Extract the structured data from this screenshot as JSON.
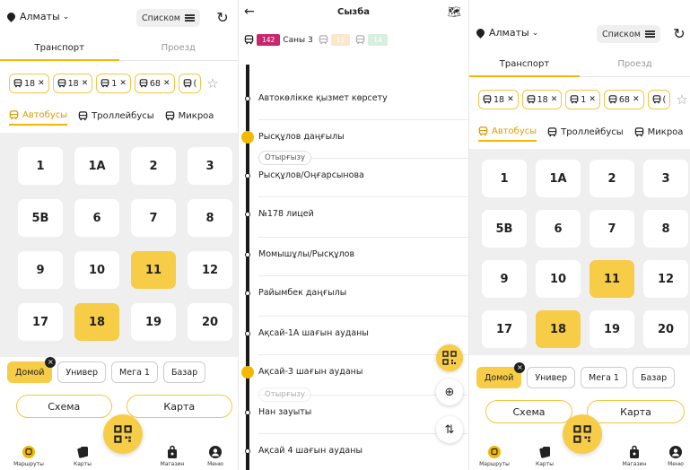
{
  "left_panel": {
    "city": "Алматы",
    "list_button": "Списком",
    "tabs": [
      "Транспорт",
      "Проезд"
    ],
    "chips": [
      "18",
      "18",
      "1",
      "68",
      "("
    ],
    "transport_tabs": [
      "Автобусы",
      "Троллейбусы",
      "Микроа"
    ],
    "routes": [
      "1",
      "1А",
      "2",
      "3",
      "5В",
      "6",
      "7",
      "8",
      "9",
      "10",
      "11",
      "12",
      "17",
      "18",
      "19",
      "20"
    ],
    "selected_routes": [
      "11",
      "18"
    ],
    "quick_places": [
      "Домой",
      "Универ",
      "Мега 1",
      "Базар"
    ],
    "quick_badge": "×",
    "scheme_button": "Схема",
    "map_button": "Карта",
    "nav": [
      "Маршруты",
      "Карты",
      "Магазин",
      "Меню"
    ]
  },
  "right_panel": {
    "city": "Алматы",
    "list_button": "Списком",
    "tabs": [
      "Транспорт",
      "Проезд"
    ],
    "chips": [
      "18",
      "18",
      "1",
      "68",
      "("
    ],
    "transport_tabs": [
      "Автобусы",
      "Троллейбусы",
      "Микроа"
    ],
    "routes": [
      "1",
      "1А",
      "2",
      "3",
      "5В",
      "6",
      "7",
      "8",
      "9",
      "10",
      "11",
      "12",
      "17",
      "18",
      "19",
      "20"
    ],
    "selected_routes": [
      "11",
      "18"
    ],
    "quick_places": [
      "Домой",
      "Универ",
      "Мега 1",
      "Базар"
    ],
    "quick_badge": "×",
    "scheme_button": "Схема",
    "map_button": "Карта",
    "nav": [
      "Маршруты",
      "Карты",
      "Магазин",
      "Меню"
    ]
  },
  "middle_panel": {
    "title": "Сызба",
    "vehicles": [
      {
        "tag": "142",
        "text": "Саны 3",
        "color": "#c8276e",
        "faded": false
      },
      {
        "tag": "11",
        "text": "",
        "color": "#f0c070",
        "faded": true
      },
      {
        "tag": "14",
        "text": "",
        "color": "#8fd4a0",
        "faded": true
      }
    ],
    "stops": [
      "Автокөлікке қызмет көрсету",
      "Рысқұлов даңғылы",
      "Рысқұлов/Оңғарсынова",
      "№178 лицей",
      "Момышұлы/Рысқұлов",
      "Райымбек даңғылы",
      "Ақсай-1А шағын ауданы",
      "Ақсай-3 шағын ауданы",
      "Нан зауыты",
      "Ақсай 4 шағын ауданы"
    ],
    "badge_1": "Отырғызу",
    "badge_2": "Отырғызу"
  },
  "colors": {
    "accent": "#f7cc47",
    "accent_dark": "#f5b800",
    "grid_bg": "#efefef",
    "line": "#1a1a1a"
  }
}
